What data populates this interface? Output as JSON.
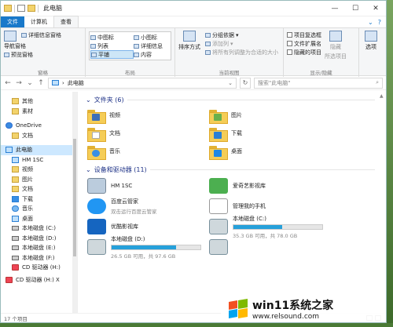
{
  "window": {
    "title": "此电脑",
    "buttons": {
      "minimize": "—",
      "maximize": "☐",
      "close": "✕"
    }
  },
  "ribbon_tabs": [
    "文件",
    "计算机",
    "查看"
  ],
  "ribbon": {
    "panes": {
      "nav_pane": "导航窗格",
      "preview_pane": "预览窗格",
      "details_pane": "详细信息窗格",
      "group_name": "窗格"
    },
    "layout": {
      "items": [
        "中图标",
        "小图标",
        "列表",
        "详细信息",
        "平铺",
        "内容"
      ],
      "group_name": "布局"
    },
    "current_view": {
      "sort": "排序方式",
      "group_by": "分组依据",
      "add_columns": "添加列",
      "fit_columns": "将所有列调整为合适的大小",
      "group_name": "当前视图"
    },
    "show_hide": {
      "item_checkboxes": "项目复选框",
      "file_extensions": "文件扩展名",
      "hidden_items": "隐藏的项目",
      "hide_selected": "隐藏",
      "hide_selected2": "所选项目",
      "group_name": "显示/隐藏"
    },
    "options": "选项"
  },
  "address": {
    "path": "此电脑",
    "search_placeholder": "搜索\"此电脑\""
  },
  "sidebar": {
    "quick": [
      {
        "label": "其他",
        "icon": "folder-icon"
      },
      {
        "label": "素材",
        "icon": "folder-icon"
      }
    ],
    "onedrive": {
      "label": "OneDrive",
      "icon": "cloud-icon"
    },
    "onedrive_children": [
      {
        "label": "文档",
        "icon": "folder-icon"
      }
    ],
    "thispc": {
      "label": "此电脑",
      "icon": "computer-icon"
    },
    "thispc_children": [
      {
        "label": "HM 1SC",
        "icon": "phone-icon"
      },
      {
        "label": "视频",
        "icon": "video-folder-icon"
      },
      {
        "label": "图片",
        "icon": "pictures-folder-icon"
      },
      {
        "label": "文档",
        "icon": "documents-folder-icon"
      },
      {
        "label": "下载",
        "icon": "download-icon"
      },
      {
        "label": "音乐",
        "icon": "music-icon"
      },
      {
        "label": "桌面",
        "icon": "desktop-icon"
      },
      {
        "label": "本地磁盘 (C:)",
        "icon": "drive-icon"
      },
      {
        "label": "本地磁盘 (D:)",
        "icon": "drive-icon"
      },
      {
        "label": "本地磁盘 (E:)",
        "icon": "drive-icon"
      },
      {
        "label": "本地磁盘 (F:)",
        "icon": "drive-icon"
      },
      {
        "label": "CD 驱动器 (H:)",
        "icon": "cd-icon"
      }
    ],
    "extra": {
      "label": "CD 驱动器 (H:) X",
      "icon": "cd-icon"
    }
  },
  "folders": {
    "heading": "文件夹 (6)",
    "items": [
      {
        "label": "视频",
        "icon": "video-folder-icon"
      },
      {
        "label": "图片",
        "icon": "pictures-folder-icon"
      },
      {
        "label": "文档",
        "icon": "documents-folder-icon"
      },
      {
        "label": "下载",
        "icon": "download-folder-icon"
      },
      {
        "label": "音乐",
        "icon": "music-folder-icon"
      },
      {
        "label": "桌面",
        "icon": "desktop-folder-icon"
      }
    ]
  },
  "devices": {
    "heading": "设备和驱动器 (11)",
    "items": [
      {
        "label": "HM 1SC",
        "sub": "",
        "icon": "phone-icon"
      },
      {
        "label": "爱奇艺影视库",
        "sub": "",
        "icon": "iqiyi-icon"
      },
      {
        "label": "百度云管家",
        "sub": "双击运行百度云管家",
        "icon": "baidu-cloud-icon"
      },
      {
        "label": "管理我的手机",
        "sub": "",
        "icon": "phone-manager-icon"
      },
      {
        "label": "优酷影视库",
        "sub": "",
        "icon": "youku-icon"
      },
      {
        "label": "本地磁盘 (C:)",
        "sub": "35.3 GB 可用，共 78.0 GB",
        "used_fraction": 0.55,
        "icon": "windows-drive-icon"
      },
      {
        "label": "本地磁盘 (D:)",
        "sub": "26.5 GB 可用，共 97.6 GB",
        "used_fraction": 0.73,
        "icon": "drive-icon"
      },
      {
        "label": "",
        "sub": "",
        "icon": "drive-icon"
      }
    ]
  },
  "status": {
    "count": "17 个项目"
  },
  "watermark": {
    "title": "win11系统之家",
    "url": "www.relsound.com"
  },
  "colors": {
    "accent": "#1979ca",
    "bar_fill": "#26a0da",
    "folder": "#f5cd57",
    "selection": "#cde8ff"
  }
}
